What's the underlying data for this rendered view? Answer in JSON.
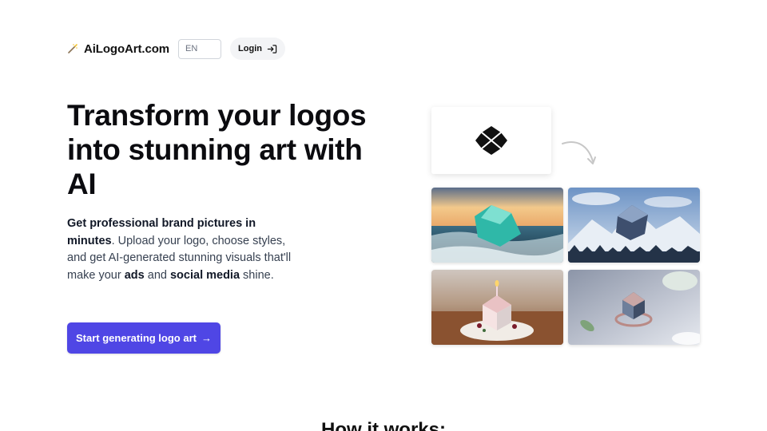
{
  "nav": {
    "brand_icon": "magic-wand-icon",
    "brand": "AiLogoArt.com",
    "language": "EN",
    "login_label": "Login",
    "login_icon": "sign-in-icon"
  },
  "hero": {
    "title": "Transform your logos into stunning art with AI",
    "description": {
      "bold1": "Get professional brand pictures in minutes",
      "text1": ". Upload your logo, choose styles, and get AI-generated stunning visuals that'll make your ",
      "bold2": "ads",
      "text2": " and ",
      "bold3": "social media",
      "text3": " shine."
    },
    "cta_label": "Start generating logo art",
    "cta_icon": "arrow-right-icon"
  },
  "gallery": {
    "source_logo": "diamond-logo",
    "arrow_icon": "curved-arrow-icon",
    "tiles": [
      "ocean-wave-logo-art",
      "snowy-mountain-logo-art",
      "cake-candle-logo-art",
      "crystal-ring-logo-art"
    ]
  },
  "how_it_works": {
    "title": "How it works:"
  },
  "colors": {
    "accent": "#4f46e5",
    "text": "#111827"
  }
}
